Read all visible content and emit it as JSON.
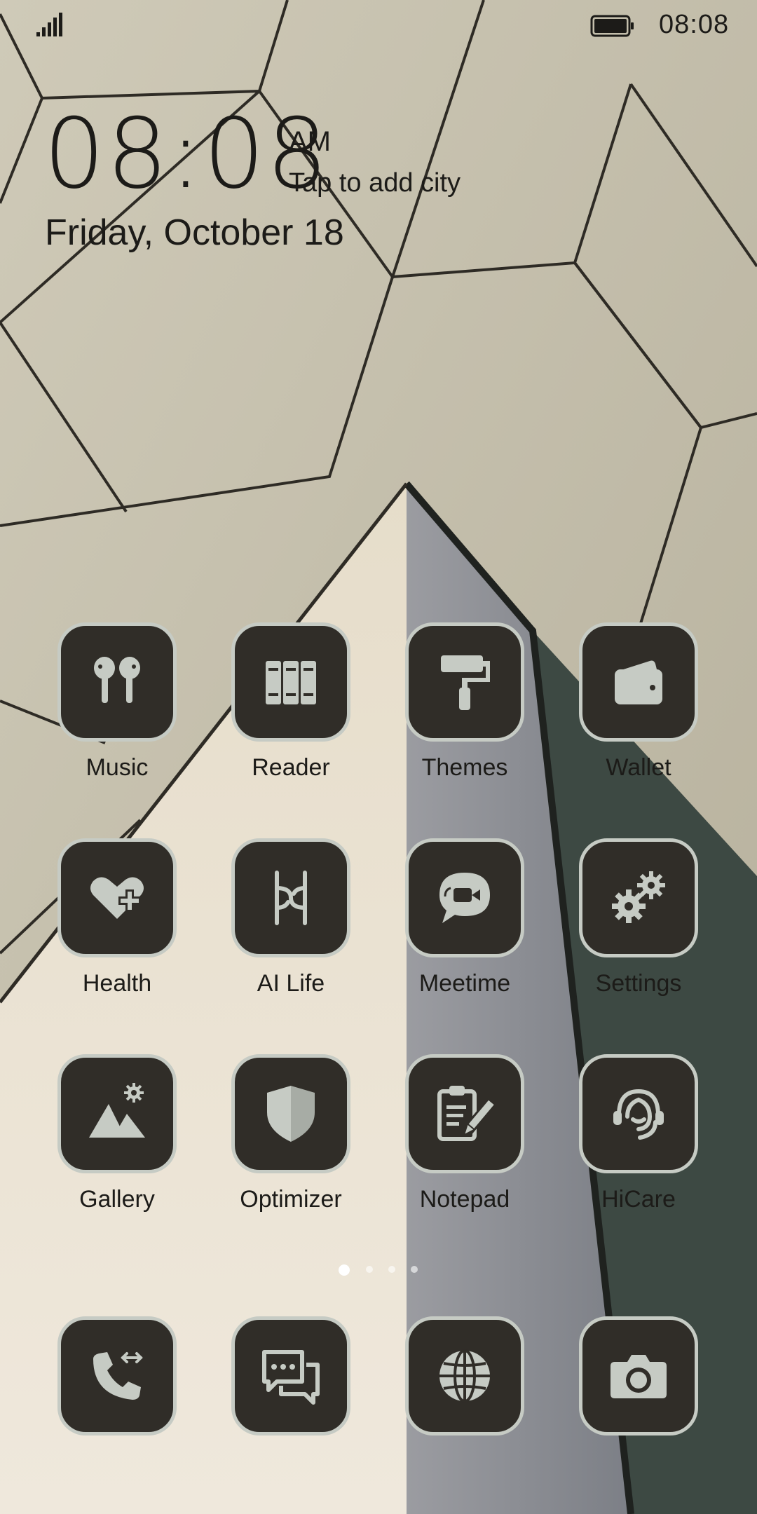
{
  "status_bar": {
    "time": "08:08",
    "signal_icon": "signal-icon",
    "battery_icon": "battery-icon"
  },
  "clock_widget": {
    "time": "08:08",
    "ampm": "AM",
    "city_prompt": "Tap to add city",
    "date": "Friday, October 18"
  },
  "apps": [
    {
      "label": "Music",
      "icon": "earbuds-icon"
    },
    {
      "label": "Reader",
      "icon": "books-icon"
    },
    {
      "label": "Themes",
      "icon": "paint-roller-icon"
    },
    {
      "label": "Wallet",
      "icon": "wallet-icon"
    },
    {
      "label": "Health",
      "icon": "heart-plus-icon"
    },
    {
      "label": "AI Life",
      "icon": "ai-life-icon"
    },
    {
      "label": "Meetime",
      "icon": "video-chat-icon"
    },
    {
      "label": "Settings",
      "icon": "gears-icon"
    },
    {
      "label": "Gallery",
      "icon": "mountains-icon"
    },
    {
      "label": "Optimizer",
      "icon": "shield-icon"
    },
    {
      "label": "Notepad",
      "icon": "clipboard-pencil-icon"
    },
    {
      "label": "HiCare",
      "icon": "headset-icon"
    }
  ],
  "dock": [
    {
      "icon": "phone-icon"
    },
    {
      "icon": "messages-icon"
    },
    {
      "icon": "globe-icon"
    },
    {
      "icon": "camera-icon"
    }
  ],
  "page_indicator": {
    "pages": 4,
    "current": 1
  },
  "colors": {
    "icon_tile": "#302d28",
    "icon_border": "#c6cbc4",
    "icon_glyph": "#c6cbc4",
    "text": "#1c1b18"
  }
}
